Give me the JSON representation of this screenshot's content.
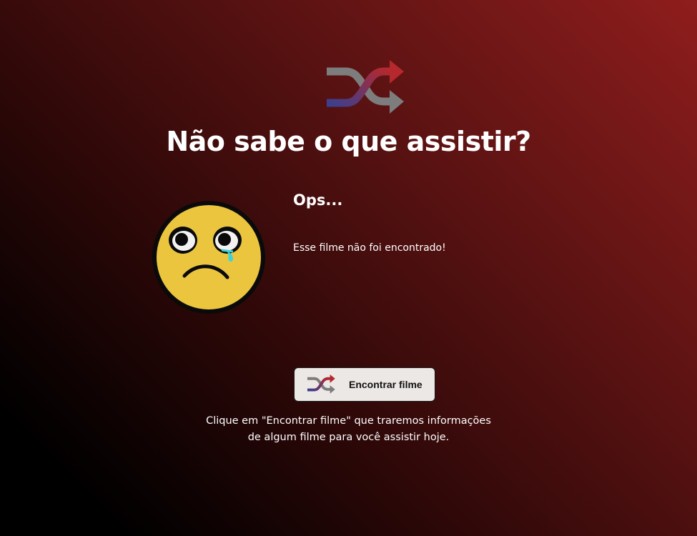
{
  "header": {
    "logo_icon": "shuffle-icon",
    "title": "Não sabe o que assistir?"
  },
  "result": {
    "image_icon": "sad-crying-face-icon",
    "heading": "Ops...",
    "message": "Esse filme não foi encontrado!"
  },
  "action": {
    "button_icon": "shuffle-icon",
    "button_label": "Encontrar filme"
  },
  "hint": {
    "line1": "Clique em \"Encontrar filme\" que traremos informações",
    "line2": "de algum filme para você assistir hoje."
  },
  "colors": {
    "accent_red": "#b5282e",
    "accent_blue": "#3b3f8f",
    "arrow_gray": "#7d7d7d",
    "button_bg": "#ece8e6",
    "face_yellow": "#ecc53f"
  }
}
